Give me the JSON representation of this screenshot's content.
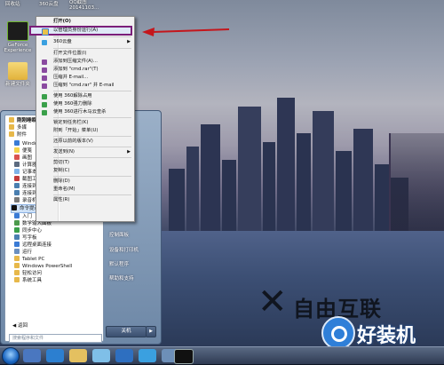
{
  "desktop": {
    "top_labels": [
      "回收站",
      "360云盘",
      "QQ截图\n20141103..."
    ],
    "icons": [
      {
        "label": "GeForce\nExperience"
      },
      {
        "label": "新建文件夹"
      }
    ]
  },
  "context_menu": {
    "items": [
      {
        "label": "打开(O)"
      },
      {
        "label": "以管理员身份运行(A)",
        "highlighted": true
      },
      {
        "label": "360云盘",
        "submenu": true
      },
      {
        "label": "打开文件位置(I)"
      },
      {
        "label": "添加到压缩文件(A)..."
      },
      {
        "label": "添加到 \"cmd.rar\"(T)"
      },
      {
        "label": "压缩并 E-mail..."
      },
      {
        "label": "压缩到 \"cmd.rar\" 并 E-mail"
      },
      {
        "label": "使用 360解除占用"
      },
      {
        "label": "使用 360强力删除"
      },
      {
        "label": "使用 360进行木马云查杀"
      },
      {
        "label": "锁定到任务栏(K)"
      },
      {
        "label": "附到「开始」菜单(U)"
      },
      {
        "label": "还原以前的版本(V)"
      },
      {
        "label": "发送到(N)",
        "submenu": true
      },
      {
        "label": "剪切(T)"
      },
      {
        "label": "复制(C)"
      },
      {
        "label": "删除(D)"
      },
      {
        "label": "重命名(M)"
      },
      {
        "label": "属性(R)"
      }
    ]
  },
  "start_menu": {
    "left_items": [
      "附件",
      "Windows",
      "便笺",
      "画图",
      "计算器",
      "记事本",
      "截图工具",
      "连接到投影仪",
      "连接到网络投影仪",
      "录音机",
      "命令提示符",
      "入门",
      "数学输入面板",
      "同步中心",
      "写字板",
      "远程桌面连接",
      "运行",
      "Tablet PC",
      "Windows PowerShell",
      "轻松访问",
      "系统工具"
    ],
    "header_items": [
      "刚刚睡眠",
      "多媒",
      "附件"
    ],
    "back_label": "返回",
    "search_placeholder": "搜索程序和文件",
    "right_items": [
      "控制面板",
      "设备和打印机",
      "默认程序",
      "帮助和支持"
    ],
    "shutdown_label": "关机"
  },
  "wallpaper": {
    "logo_text": "自由互联",
    "brand_text": "好装机"
  },
  "colors": {
    "highlight_border": "#7b1f7a",
    "annotation_arrow": "#c4161c",
    "start_menu_bg": "#8aa0bb"
  }
}
